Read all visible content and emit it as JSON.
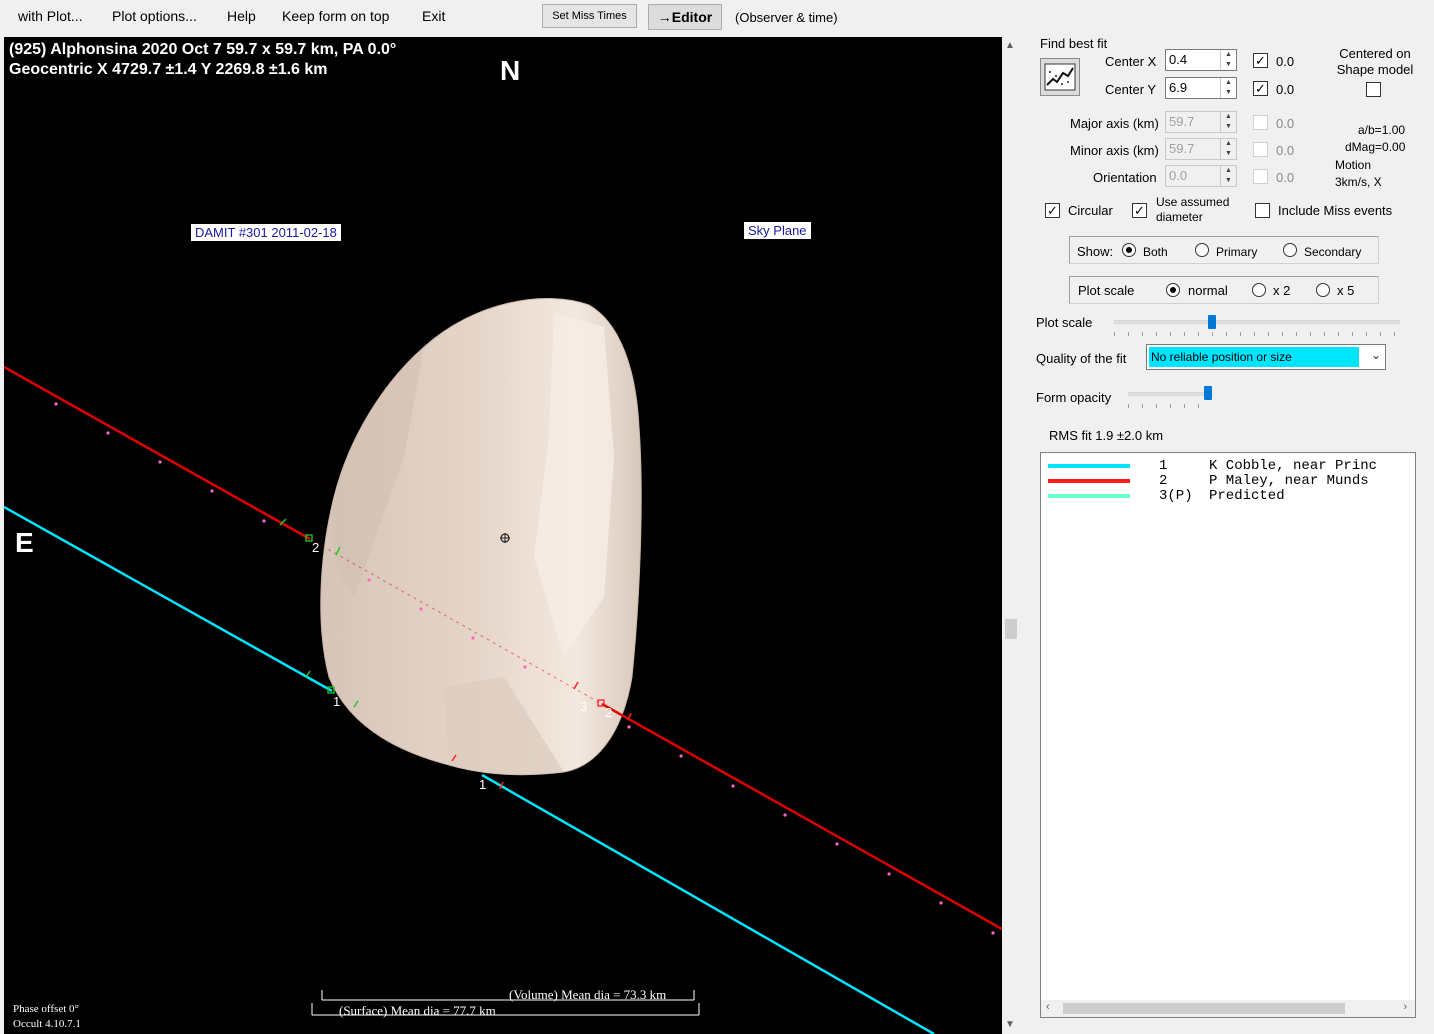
{
  "menubar": {
    "items": [
      "with Plot...",
      "Plot options...",
      "Help",
      "Keep form on top",
      "Exit"
    ],
    "set_miss_times": "Set Miss Times",
    "editor": "→Editor",
    "observer_time": "(Observer & time)"
  },
  "plot": {
    "title_line1": "(925) Alphonsina  2020 Oct 7  59.7 x 59.7 km, PA 0.0°",
    "title_line2": "Geocentric  X  4729.7 ±1.4  Y 2269.8 ±1.6 km",
    "north": "N",
    "east": "E",
    "damit_label": "DAMIT #301 2011-02-18",
    "sky_plane": "Sky Plane",
    "volume_dia": "(Volume) Mean dia = 73.3 km",
    "surface_dia": "(Surface) Mean dia = 77.7 km",
    "phase_offset": "Phase offset 0°",
    "occult_version": "Occult 4.10.7.1",
    "chord_labels": [
      "2",
      "1",
      "3",
      "2",
      "1"
    ]
  },
  "panel": {
    "find_best_fit": "Find best fit",
    "center_x_label": "Center X",
    "center_x_value": "0.4",
    "center_x_check_value": "0.0",
    "center_y_label": "Center Y",
    "center_y_value": "6.9",
    "center_y_check_value": "0.0",
    "centered_on_shape": "Centered on Shape model",
    "major_axis_label": "Major axis (km)",
    "major_axis_value": "59.7",
    "major_axis_check_value": "0.0",
    "minor_axis_label": "Minor axis (km)",
    "minor_axis_value": "59.7",
    "minor_axis_check_value": "0.0",
    "orientation_label": "Orientation",
    "orientation_value": "0.0",
    "orientation_check_value": "0.0",
    "ab_ratio": "a/b=1.00",
    "dmag": "dMag=0.00",
    "motion_label": "Motion",
    "motion_value": "3km/s, X",
    "circular": "Circular",
    "use_assumed_diameter": "Use assumed diameter",
    "include_miss_events": "Include Miss events",
    "show_label": "Show:",
    "show_options": [
      "Both",
      "Primary",
      "Secondary"
    ],
    "plot_scale_group_label": "Plot scale",
    "plot_scale_options": [
      "normal",
      "x 2",
      "x 5"
    ],
    "plot_scale_slider_label": "Plot scale",
    "quality_label": "Quality of the fit",
    "quality_value": "No reliable position or size",
    "form_opacity_label": "Form opacity",
    "rms_fit": "RMS fit  1.9 ±2.0 km"
  },
  "observers": [
    {
      "num": "1",
      "name": "K Cobble, near Princ",
      "color": "#00e5ff"
    },
    {
      "num": "2",
      "name": "P Maley, near Munds",
      "color": "#ff1a1a"
    },
    {
      "num": "3(P)",
      "name": "Predicted",
      "color": "#66ffcc"
    }
  ],
  "colors": {
    "chord_observer_1": "#00e5ff",
    "chord_observer_2": "#e00000",
    "shape_fill": "#e8d8cc",
    "quality_highlight": "#00e5ff"
  }
}
